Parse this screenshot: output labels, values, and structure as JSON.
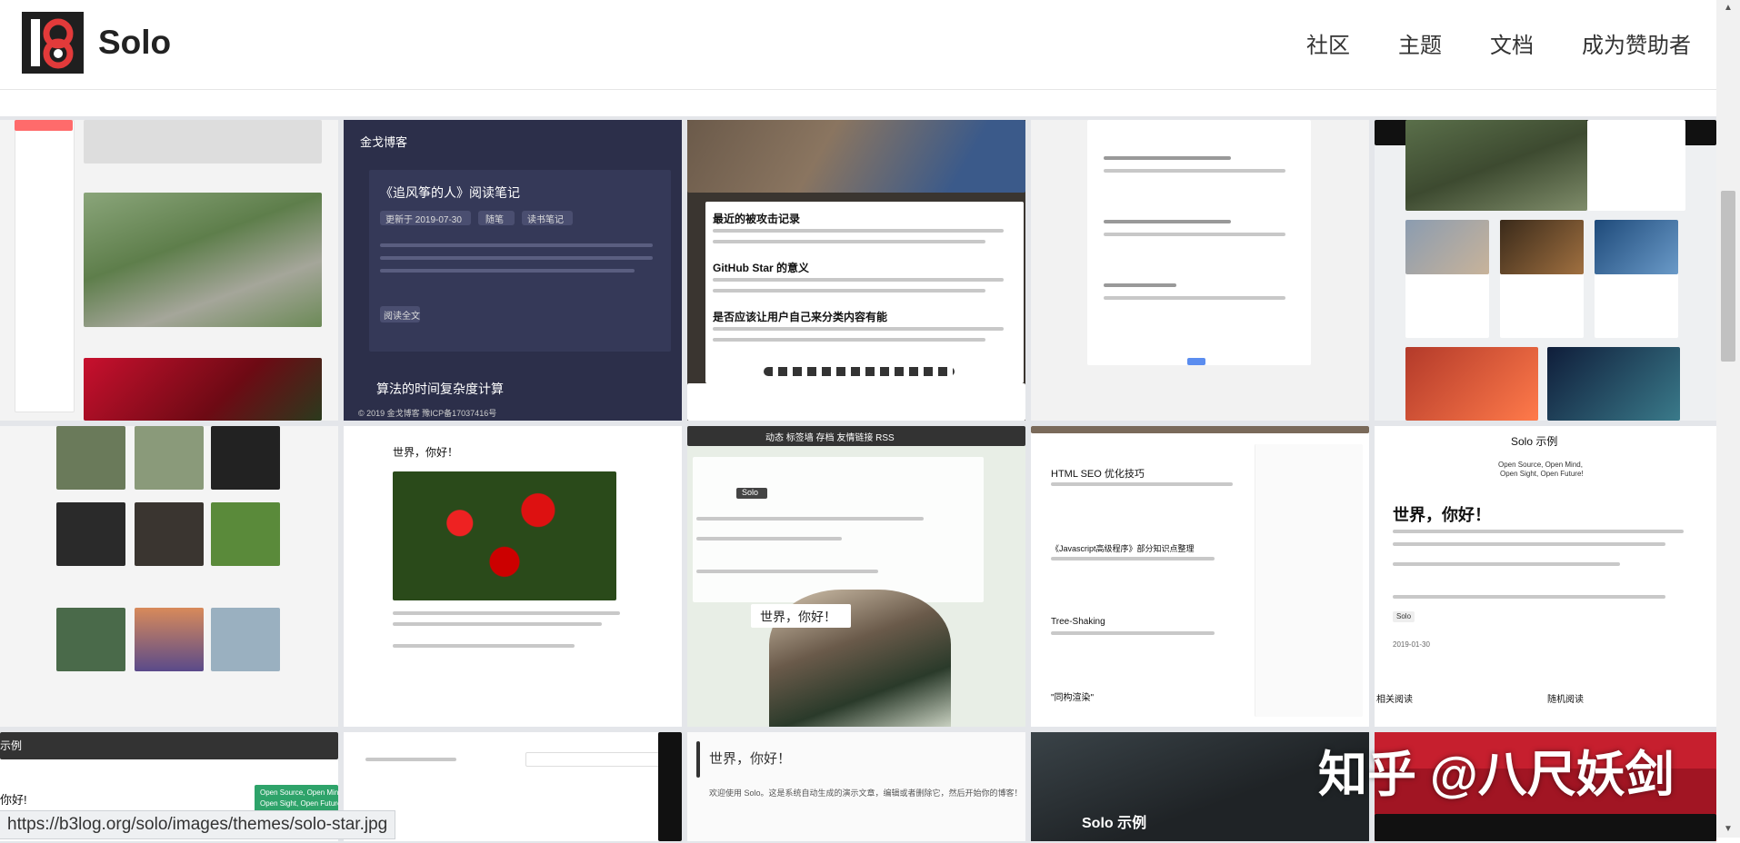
{
  "brand": {
    "name": "Solo",
    "logo_text": "b3"
  },
  "nav": [
    "社区",
    "主题",
    "文档",
    "成为赞助者"
  ],
  "status_url": "https://b3log.org/solo/images/themes/solo-star.jpg",
  "watermark": "知乎 @八尺妖剑",
  "tiles": {
    "t2_title": "金戈博客",
    "t2_post1": "《追风筝的人》阅读笔记",
    "t2_date": "更新于 2019-07-30",
    "t2_tag1": "随笔",
    "t2_tag2": "读书笔记",
    "t2_readmore": "阅读全文",
    "t2_post2": "算法的时间复杂度计算",
    "t2_footer": "© 2019 金戈博客 豫ICP备17037416号",
    "t3_post1": "最近的被攻击记录",
    "t3_post2": "GitHub Star 的意义",
    "t3_post3": "是否应该让用户自己来分类内容有能",
    "t6_title": "世界，你好！",
    "t7_nav": "动态  标签墙  存档  友情链接  RSS",
    "t7_tag": "Solo",
    "t7_title": "世界，你好！",
    "t8_post1": "HTML SEO 优化技巧",
    "t8_post2": "《Javascript高级程序》部分知识点整理",
    "t8_post3": "Tree-Shaking",
    "t8_post4": "\"同构渲染\"",
    "t9_title": "Solo 示例",
    "t9_sub1": "Open Source, Open Mind,",
    "t9_sub2": "Open Sight, Open Future!",
    "t9_heading": "世界，你好！",
    "t9_tag": "Solo",
    "t9_date": "2019-01-30",
    "t9_related": "相关阅读",
    "t9_random": "随机阅读",
    "t10_title": "示例",
    "t10_heading": "你好!",
    "t10_banner1": "Open Source, Open Mind,",
    "t10_banner2": "Open Sight, Open Future!",
    "t12_title": "世界，你好！",
    "t12_line1": "欢迎使用 Solo。这是系统自动生成的演示文章，编辑或者删除它，然后开始你的博客！",
    "t13_title": "Solo 示例"
  }
}
